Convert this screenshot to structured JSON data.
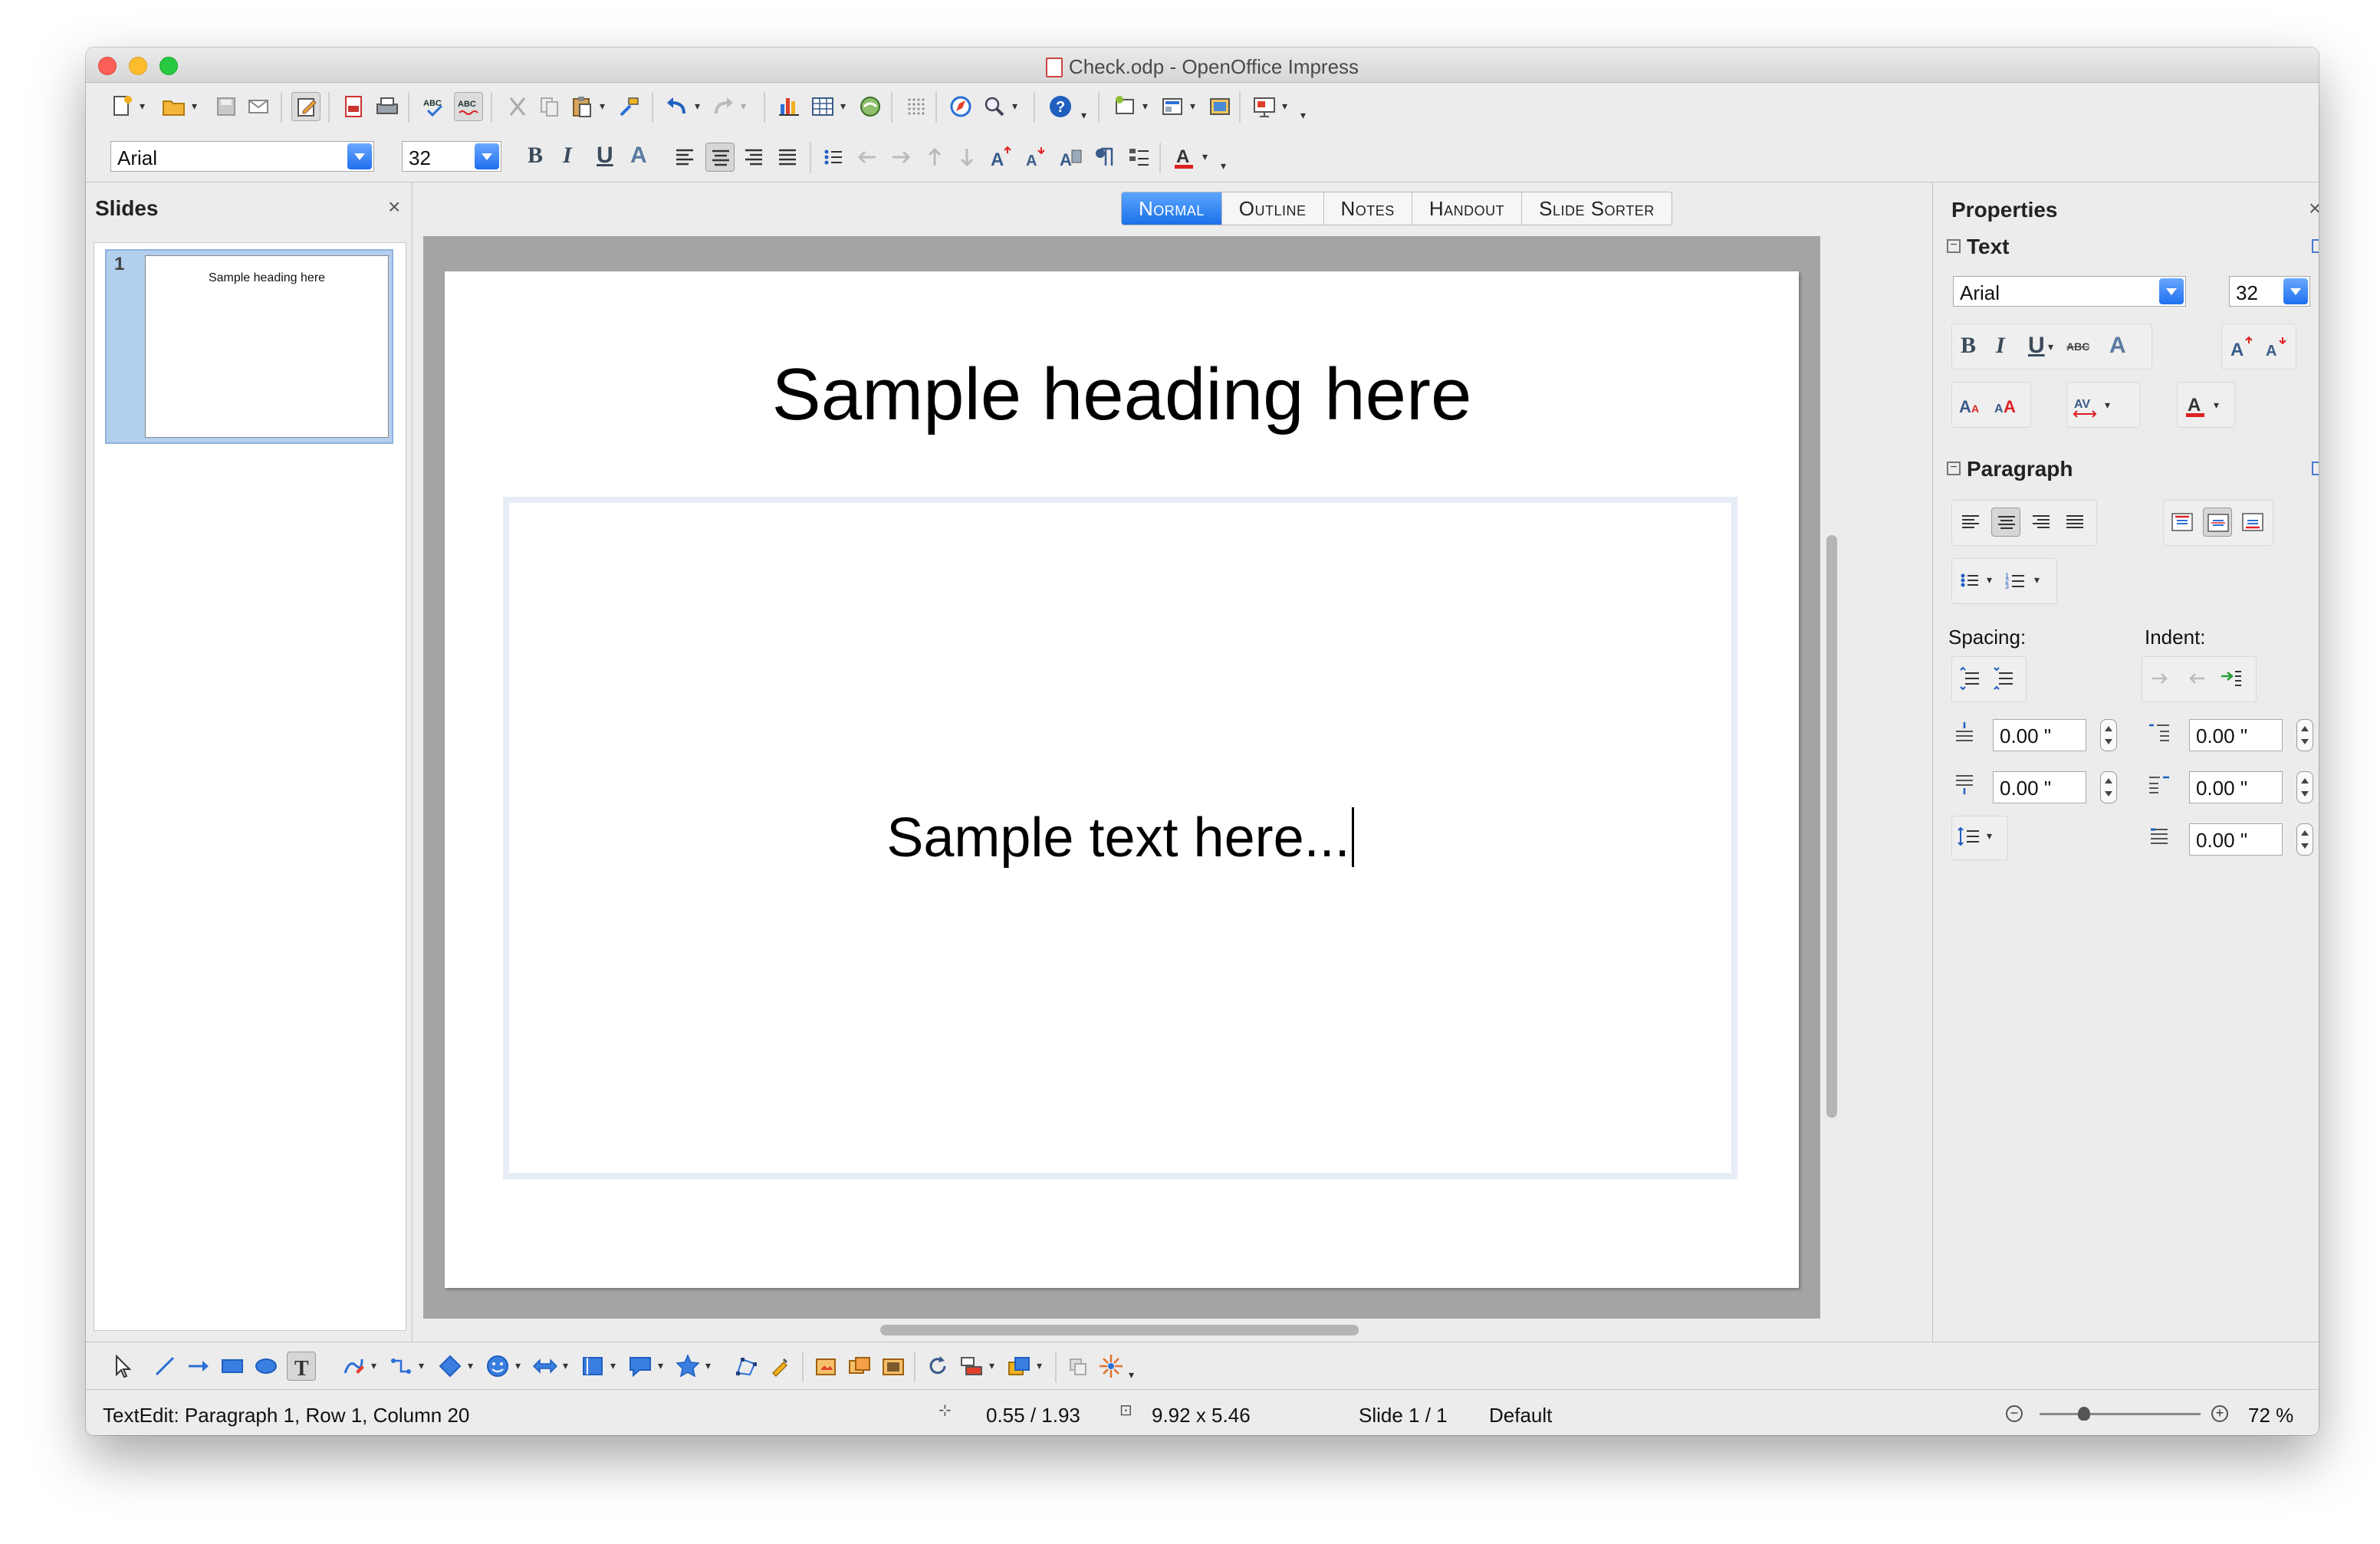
{
  "window": {
    "title": "Check.odp - OpenOffice Impress"
  },
  "format_bar": {
    "font_name": "Arial",
    "font_size": "32"
  },
  "slides_panel": {
    "title": "Slides",
    "close": "×",
    "thumbnails": [
      {
        "number": "1",
        "heading": "Sample heading here"
      }
    ]
  },
  "view_tabs": [
    {
      "label": "Normal",
      "active": true
    },
    {
      "label": "Outline"
    },
    {
      "label": "Notes"
    },
    {
      "label": "Handout"
    },
    {
      "label": "Slide Sorter"
    }
  ],
  "slide": {
    "heading": "Sample heading here",
    "body": "Sample text here..."
  },
  "properties": {
    "title": "Properties",
    "close": "×",
    "text_section": {
      "title": "Text",
      "font_name": "Arial",
      "font_size": "32"
    },
    "paragraph_section": {
      "title": "Paragraph",
      "spacing_label": "Spacing:",
      "indent_label": "Indent:",
      "above_spacing": "0.00 \"",
      "below_spacing": "0.00 \"",
      "before_indent": "0.00 \"",
      "after_indent": "0.00 \"",
      "first_line_indent": "0.00 \""
    }
  },
  "status_bar": {
    "edit_info": "TextEdit: Paragraph 1, Row 1, Column 20",
    "position": "0.55 / 1.93",
    "size": "9.92 x 5.46",
    "slide": "Slide 1 / 1",
    "master": "Default",
    "zoom": "72 %"
  },
  "colors": {
    "accent": "#1f6ff0",
    "selection": "#b3cfee"
  }
}
